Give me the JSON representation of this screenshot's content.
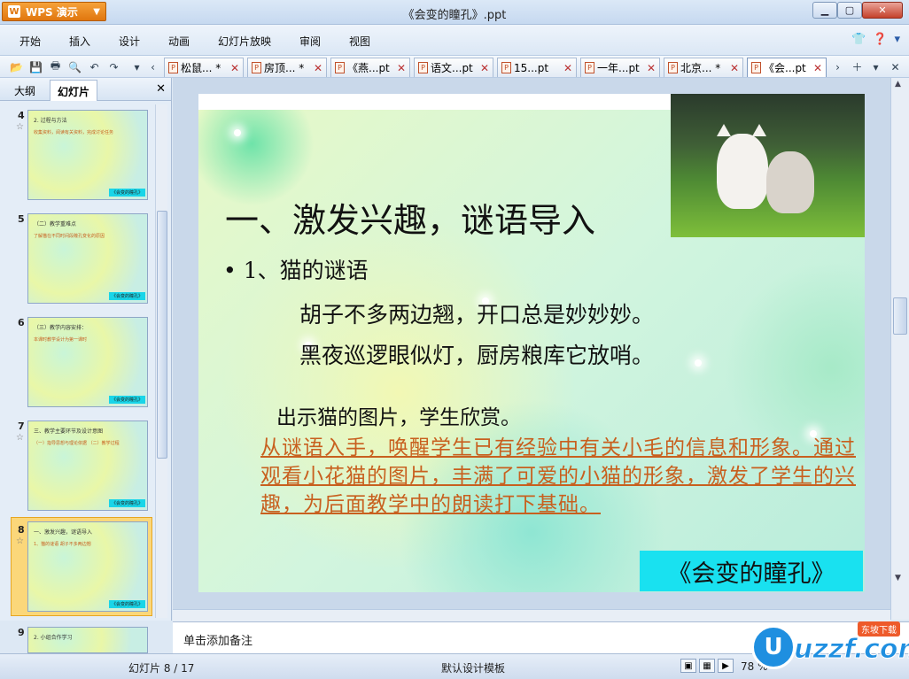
{
  "window": {
    "app_name": "WPS 演示",
    "title": "《会变的瞳孔》.ppt"
  },
  "menu": [
    "开始",
    "插入",
    "设计",
    "动画",
    "幻灯片放映",
    "审阅",
    "视图"
  ],
  "doc_tabs": [
    {
      "label": "松鼠... *",
      "active": false
    },
    {
      "label": "房顶... *",
      "active": false
    },
    {
      "label": "《燕...pt",
      "active": false
    },
    {
      "label": "语文...pt",
      "active": false
    },
    {
      "label": "15...pt",
      "active": false
    },
    {
      "label": "一年...pt",
      "active": false
    },
    {
      "label": "北京... *",
      "active": false
    },
    {
      "label": "《会...pt",
      "active": true
    }
  ],
  "left_panel": {
    "tabs": [
      "大纲",
      "幻灯片"
    ],
    "active_tab": "幻灯片",
    "thumbnails": [
      {
        "num": "4",
        "title": "2. 过程与方法",
        "body": "收集资料，阅读有关资料，完成讨论任务",
        "footer": "《会变的瞳孔》"
      },
      {
        "num": "5",
        "title": "（二）教学重难点",
        "body": "了解猫在不同时间段瞳孔变化的原因",
        "footer": "《会变的瞳孔》"
      },
      {
        "num": "6",
        "title": "（三）教学内容安排：",
        "body": "本课时教学设计为第一课时",
        "footer": "《会变的瞳孔》"
      },
      {
        "num": "7",
        "title": "三、教学主要环节及设计意图",
        "body": "（一）指导思想与理论依据 （二）教学过程",
        "footer": "《会变的瞳孔》"
      },
      {
        "num": "8",
        "title": "一、激发兴趣，谜语导入",
        "body": "1、猫的谜语 胡子不多两边翘",
        "footer": "《会变的瞳孔》"
      },
      {
        "num": "9",
        "title": "2. 小组合作学习",
        "body": "",
        "footer": ""
      }
    ]
  },
  "slide": {
    "title": "一、激发兴趣，谜语导入",
    "bullet": "1、猫的谜语",
    "riddle_lines": [
      "胡子不多两边翘，开口总是妙妙妙。",
      "黑夜巡逻眼似灯，厨房粮库它放哨。"
    ],
    "note": "出示猫的图片，学生欣赏。",
    "description": "从谜语入手，唤醒学生已有经验中有关小毛的信息和形象。通过观看小花猫的图片，丰满了可爱的小猫的形象，激发了学生的兴趣，为后面教学中的朗读打下基础。",
    "footer_label": "《会变的瞳孔》"
  },
  "notes_placeholder": "单击添加备注",
  "status": {
    "slide_indicator": "幻灯片 8 / 17",
    "template": "默认设计模板",
    "zoom": "78 %"
  },
  "watermark": {
    "main": "uzzf.com",
    "badge": "东坡下载"
  },
  "colors": {
    "accent_orange": "#e0760e",
    "footer_cyan": "#19e1f0",
    "desc_text": "#c8601f"
  }
}
